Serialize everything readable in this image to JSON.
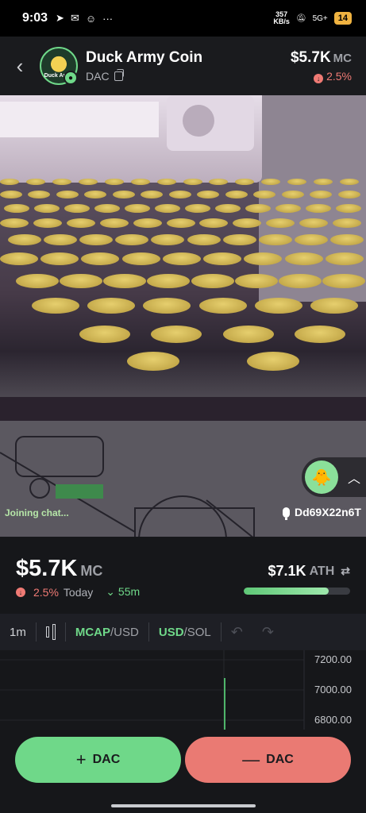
{
  "status_bar": {
    "time": "9:03",
    "net_speed": "357",
    "net_unit": "KB/s",
    "signal": "5G+",
    "battery": "14"
  },
  "header": {
    "coin_name": "Duck Army Coin",
    "ticker": "DAC",
    "market_cap": "$5.7K",
    "mc_label": "MC",
    "change": "2.5%",
    "avatar_text": "Duck Army"
  },
  "stream": {
    "chat_status": "Joining chat...",
    "streamer": "Dd69X22n6T"
  },
  "stats": {
    "market_cap": "$5.7K",
    "mc_label": "MC",
    "change": "2.5%",
    "period": "Today",
    "age": "55m",
    "ath_value": "$7.1K",
    "ath_label": "ATH",
    "ath_progress": 0.8
  },
  "toolbar": {
    "interval": "1m",
    "mcap_label": "MCAP",
    "usd_label": "/USD",
    "usd2_label": "USD",
    "sol_label": "/SOL"
  },
  "chart_data": {
    "type": "line",
    "y_ticks": [
      "7200.00",
      "7000.00",
      "6800.00"
    ],
    "ylim": [
      6800,
      7200
    ]
  },
  "actions": {
    "buy_label": "DAC",
    "sell_label": "DAC"
  },
  "colors": {
    "accent_green": "#6fd889",
    "accent_red": "#ea7a73",
    "background": "#16171a"
  }
}
